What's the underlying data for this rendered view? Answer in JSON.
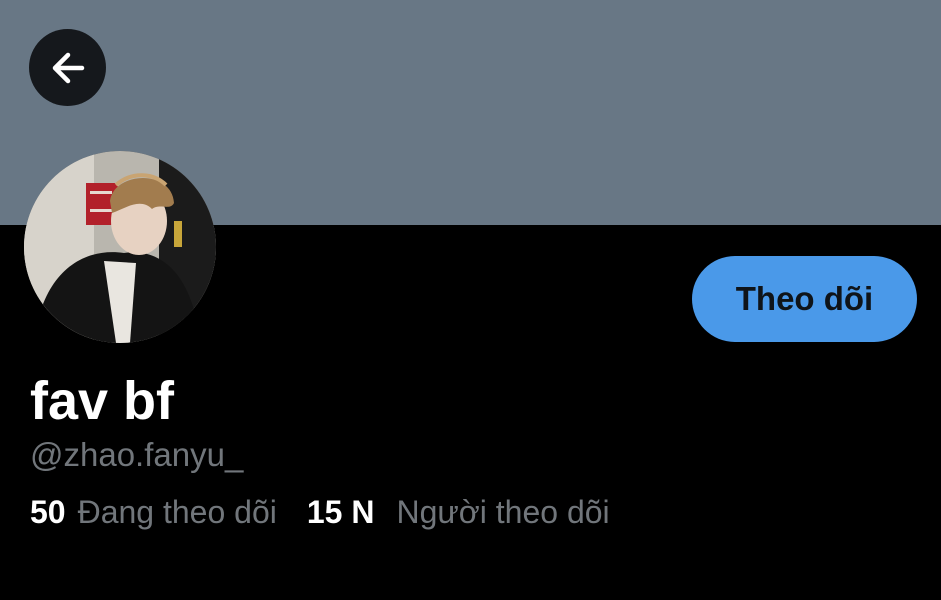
{
  "profile": {
    "display_name": "fav bf",
    "handle": "@zhao.fanyu_",
    "following_count": "50",
    "following_label": "Đang theo dõi",
    "followers_count": "15 N",
    "followers_label": "Người theo dõi"
  },
  "actions": {
    "follow_label": "Theo dõi"
  },
  "icons": {
    "back": "arrow-left-icon"
  },
  "colors": {
    "banner": "#687785",
    "background": "#000000",
    "follow_button": "#4a99e9",
    "secondary_text": "#71767b"
  }
}
